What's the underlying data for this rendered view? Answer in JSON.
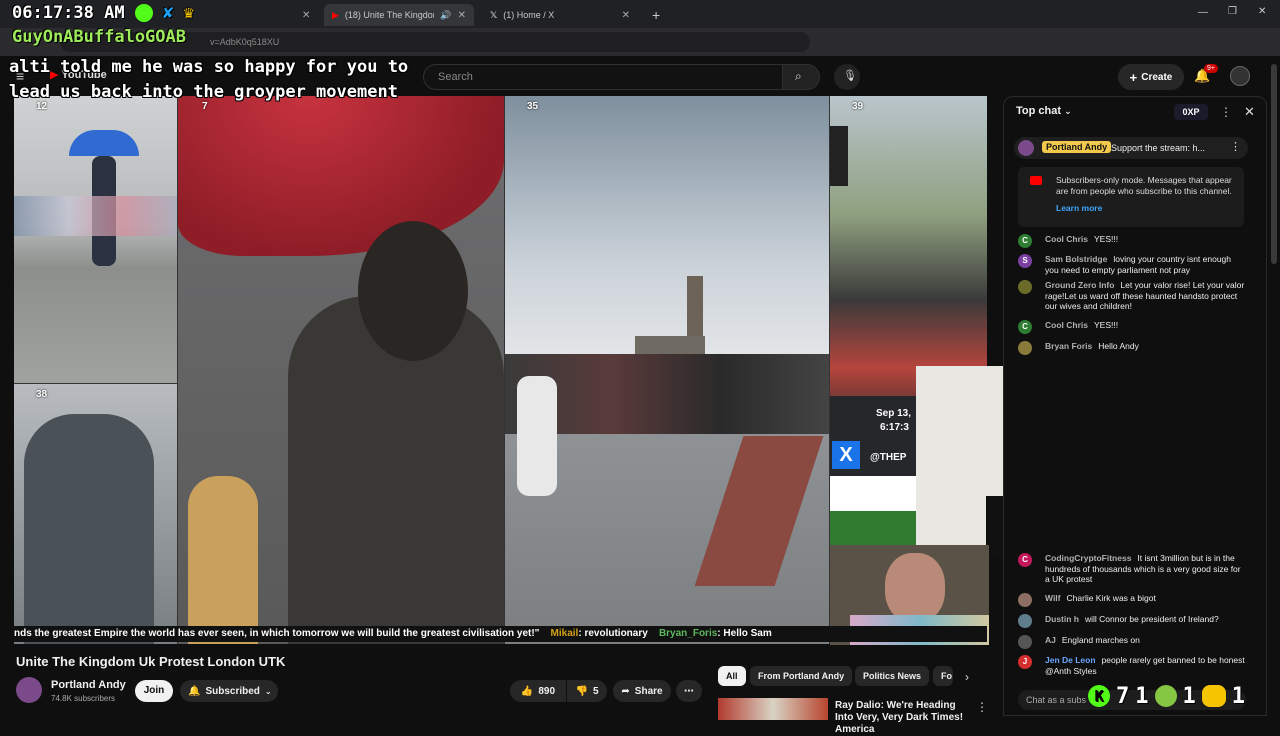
{
  "browser": {
    "tabs": [
      {
        "title": "(18) Unite The Kingdom Uk",
        "active": true
      },
      {
        "title": "(1) Home / X",
        "active": false
      }
    ],
    "new_tab": "+",
    "url": "v=AdbK0q518XU"
  },
  "overlay": {
    "clock": "06:17:38 AM",
    "streamer": "GuyOnABuffaloGOAB",
    "caption": "alti told me he was so happy for you to lead us back into the groyper movement"
  },
  "youtube": {
    "logo": "YouTube",
    "search_placeholder": "Search",
    "create_label": "Create",
    "notif_badge": "9+"
  },
  "video": {
    "tiktok_counts": [
      "12",
      "7",
      "35",
      "39",
      "38"
    ],
    "x_timestamp": "Sep 13,",
    "x_time": "6:17:3",
    "x_handle": "@THEP",
    "ticker_quote": "nds the greatest Empire the world has ever seen, in which tomorrow we will build the greatest civilisation yet!\"",
    "ticker_user1": "Mikail",
    "ticker_msg1": ": revolutionary",
    "ticker_user2": "Bryan_Foris",
    "ticker_msg2": ": Hello Sam",
    "title": "Unite The Kingdom Uk Protest London UTK",
    "channel": "Portland Andy",
    "subscribers": "74.8K subscribers",
    "join_label": "Join",
    "subscribed_label": "Subscribed",
    "likes": "890",
    "dislikes": "5",
    "share_label": "Share"
  },
  "recommendations": {
    "chips": [
      "All",
      "From Portland Andy",
      "Politics News",
      "Fo"
    ],
    "first_title": "Ray Dalio: We're Heading Into Very, Very Dark Times! America"
  },
  "chat": {
    "mode": "Top chat",
    "xp": "0XP",
    "pinned_author": "Portland Andy",
    "pinned_text": "Support the stream: h...",
    "subs_only_text": "Subscribers-only mode. Messages that appear are from people who subscribe to this channel.",
    "learn_more": "Learn more",
    "messages": [
      {
        "author": "Cool Chris",
        "text": "YES!!!",
        "initial": "C",
        "color": "#2e7d32"
      },
      {
        "author": "Sam Bolstridge",
        "text": "loving your country isnt enough you need to empty parliament not pray",
        "initial": "S",
        "color": "#7b3fa0"
      },
      {
        "author": "Ground Zero Info",
        "text": "Let your valor rise! Let your valor rage!Let us ward off these haunted handsto protect our wives and children!",
        "initial": "",
        "color": "#6b6b2a"
      },
      {
        "author": "Cool Chris",
        "text": "YES!!!",
        "initial": "C",
        "color": "#2e7d32"
      },
      {
        "author": "Bryan Foris",
        "text": "Hello Andy",
        "initial": "",
        "color": "#8a7a3a"
      },
      {
        "author": "CodingCryptoFitness",
        "text": "It isnt 3million but is in the hundreds of thousands which is a very good size for a UK protest",
        "initial": "C",
        "color": "#c2185b"
      },
      {
        "author": "Wilf",
        "text": "Charlie Kirk was a bigot",
        "initial": "",
        "color": "#8d6e63"
      },
      {
        "author": "Dustin h",
        "text": "will Connor be president of Ireland?",
        "initial": "",
        "color": "#607d8b"
      },
      {
        "author": "AJ",
        "text": "England marches on",
        "initial": "",
        "color": "#555555"
      },
      {
        "author": "Jen De Leon",
        "text": "people rarely get banned to be honest @Anth Styles",
        "initial": "J",
        "color": "#d32f2f"
      }
    ],
    "input_placeholder": "Chat as a subs"
  },
  "kick": {
    "count1": "7",
    "count2": "1",
    "count3": "1",
    "count4": "1"
  },
  "colors": {
    "accent_green": "#53fc18",
    "yt_bg": "#0f0f0f",
    "pinned_gold": "#f2c94c"
  }
}
